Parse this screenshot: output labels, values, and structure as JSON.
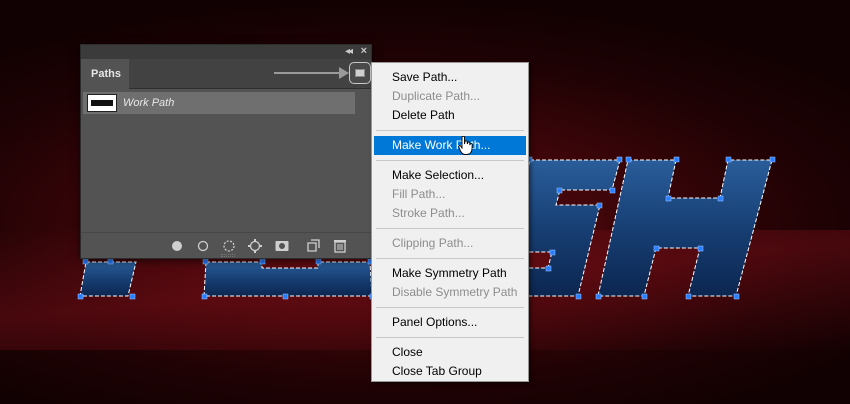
{
  "panel": {
    "tab_label": "Paths",
    "path_name": "Work Path",
    "icons": [
      "panel-collapse-icon",
      "panel-close-icon",
      "panel-menu-icon",
      "fill-path-icon",
      "stroke-path-icon",
      "load-selection-icon",
      "make-work-path-icon",
      "add-mask-icon",
      "new-path-icon",
      "trash-icon"
    ]
  },
  "menu": {
    "items": [
      {
        "label": "Save Path...",
        "enabled": true
      },
      {
        "label": "Duplicate Path...",
        "enabled": false
      },
      {
        "label": "Delete Path",
        "enabled": true
      },
      {
        "label": "Make Work Path...",
        "enabled": true,
        "highlighted": true
      },
      {
        "label": "Make Selection...",
        "enabled": true
      },
      {
        "label": "Fill Path...",
        "enabled": false
      },
      {
        "label": "Stroke Path...",
        "enabled": false
      },
      {
        "label": "Clipping Path...",
        "enabled": false
      },
      {
        "label": "Make Symmetry Path",
        "enabled": true
      },
      {
        "label": "Disable Symmetry Path",
        "enabled": false
      },
      {
        "label": "Panel Options...",
        "enabled": true
      },
      {
        "label": "Close",
        "enabled": true
      },
      {
        "label": "Close Tab Group",
        "enabled": true
      }
    ]
  },
  "colors": {
    "menu_highlight": "#0078d7",
    "anchor_points": "#2a7fff",
    "background_red": "#3a0509"
  }
}
